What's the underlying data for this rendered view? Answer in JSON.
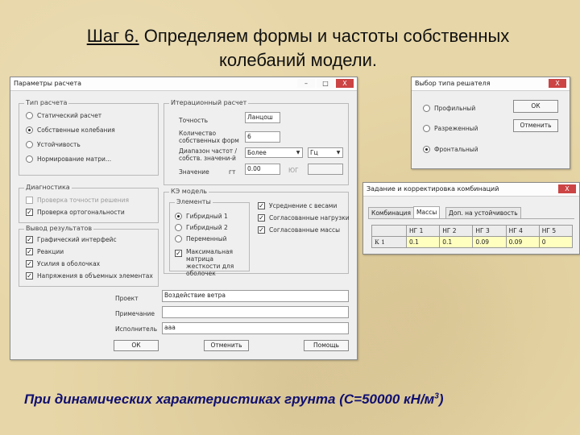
{
  "slide": {
    "title_step": "Шаг 6.",
    "title_rest": " Определяем формы и частоты собственных",
    "title_line2": "колебаний модели.",
    "footer_text": "При динамических характеристиках грунта (С=50000 кН/м",
    "footer_sup": "3",
    "footer_tail": ")"
  },
  "params_window": {
    "title": "Параметры расчета",
    "calc_type": {
      "caption": "Тип расчета",
      "options": [
        "Статический расчет",
        "Собственные колебания",
        "Устойчивость",
        "Нормирование матри..."
      ],
      "selected_index": 1
    },
    "iter": {
      "caption": "Итерационный расчет",
      "method_value": "Ланцош",
      "accuracy_label": "Точность",
      "count_label": "Количество собственных форм",
      "count_value": "6",
      "range_label": "Диапазон частот / собств. значени-й",
      "range_select": "Более",
      "range_unit": "Гц",
      "value_label": "Значение",
      "value_unit": "гт",
      "value_value": "0.00",
      "value_unit2": "ЮГ"
    },
    "diagnostics": {
      "caption": "Диагностика",
      "items": [
        {
          "label": "Проверка точности решения",
          "checked": false,
          "disabled": true
        },
        {
          "label": "Проверка ортогональности",
          "checked": true,
          "disabled": false
        }
      ]
    },
    "results": {
      "caption": "Вывод результатов",
      "items": [
        {
          "label": "Графический интерфейс",
          "checked": true
        },
        {
          "label": "Реакции",
          "checked": true
        },
        {
          "label": "Усилия в оболочках",
          "checked": true
        },
        {
          "label": "Напряжения в объемных элементах",
          "checked": true
        }
      ]
    },
    "ce_model": {
      "caption": "КЭ модель",
      "elements_caption": "Элементы",
      "elements": [
        "Гибридный 1",
        "Гибридный 2",
        "Переменный"
      ],
      "elements_selected": 0,
      "mass_label": "Максимальная матрица жесткости для оболочек",
      "mass_checked": true,
      "right_items": [
        {
          "label": "Усреднение с весами",
          "checked": true
        },
        {
          "label": "Согласованные нагрузки",
          "checked": true
        },
        {
          "label": "Согласованные массы",
          "checked": true
        }
      ]
    },
    "project_label": "Проект",
    "project_value": "Воздействие ветра",
    "note_label": "Примечание",
    "note_value": "",
    "executor_label": "Исполнитель",
    "executor_value": "ааа",
    "ok_label": "ОК",
    "cancel_label": "Отменить",
    "help_label": "Помощь"
  },
  "solver_window": {
    "title": "Выбор типа решателя",
    "options": [
      "Профильный",
      "Разреженный",
      "Фронтальный"
    ],
    "selected_index": 2,
    "ok_label": "ОК",
    "cancel_label": "Отменить"
  },
  "combo_window": {
    "title": "Задание и корректировка комбинаций",
    "tabs": [
      "Комбинация",
      "Массы",
      "Доп. на устойчивость"
    ],
    "active_tab": 1,
    "headers": [
      "",
      "НГ 1",
      "НГ 2",
      "НГ 3",
      "НГ 4",
      "НГ 5"
    ],
    "row_label": "К 1",
    "row_values": [
      "0.1",
      "0.1",
      "0.09",
      "0.09",
      "0"
    ]
  },
  "window_buttons": {
    "minimize": "–",
    "maximize": "□",
    "close": "X"
  }
}
